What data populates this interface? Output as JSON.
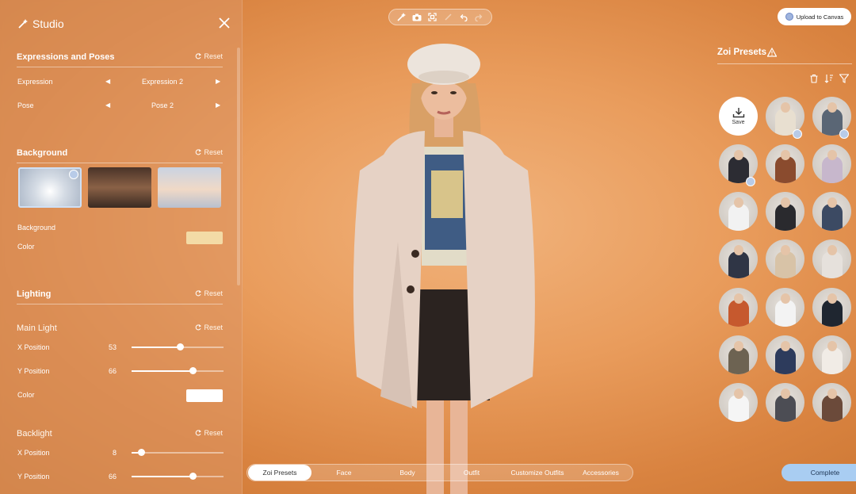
{
  "studio": {
    "title": "Studio"
  },
  "expressions": {
    "title": "Expressions and Poses",
    "reset": "Reset",
    "expression_label": "Expression",
    "expression_value": "Expression 2",
    "pose_label": "Pose",
    "pose_value": "Pose 2"
  },
  "background": {
    "title": "Background",
    "reset": "Reset",
    "color_label_1": "Background",
    "color_label_2": "Color",
    "color": "#f3dba6"
  },
  "lighting": {
    "title": "Lighting",
    "reset": "Reset",
    "main_light": {
      "title": "Main Light",
      "reset": "Reset",
      "x_label": "X Position",
      "x_value": "53",
      "y_label": "Y Position",
      "y_value": "66",
      "color_label": "Color",
      "color": "#ffffff"
    },
    "backlight": {
      "title": "Backlight",
      "reset": "Reset",
      "x_label": "X Position",
      "x_value": "8",
      "y_label": "Y Position",
      "y_value": "66"
    }
  },
  "toolbar": {
    "icons": [
      "magic-icon",
      "camera-icon",
      "frame-icon",
      "brush-icon",
      "undo-icon",
      "redo-icon"
    ]
  },
  "upload": {
    "label": "Upload to Canvas"
  },
  "presets": {
    "title": "Zoi Presets",
    "save_label": "Save"
  },
  "tabs": [
    "Zoi Presets",
    "Face",
    "Body",
    "Outfit",
    "Customize Outfits",
    "Accessories"
  ],
  "complete_label": "Complete",
  "colors": {
    "accent": "#a9cdf2",
    "panel": "#dc9664"
  }
}
